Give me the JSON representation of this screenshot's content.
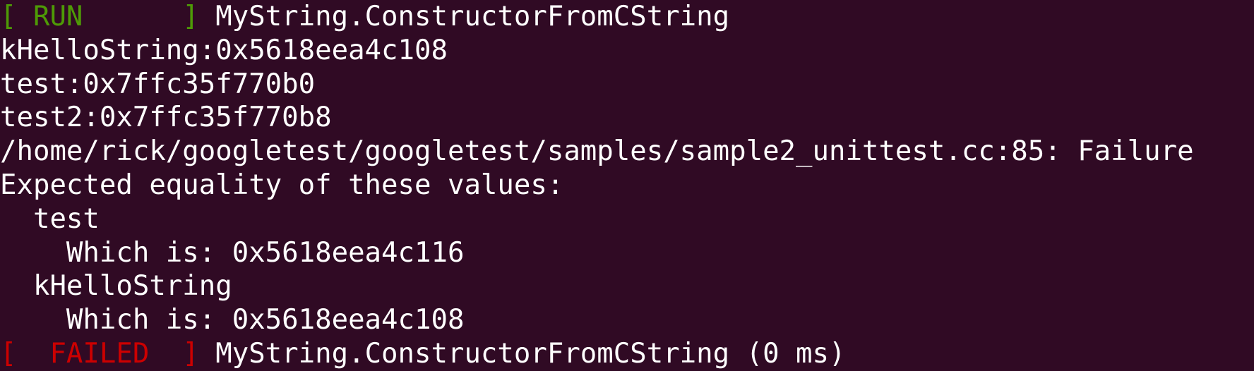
{
  "colors": {
    "background": "#300a24",
    "text": "#ffffff",
    "run_tag": "#4e9a06",
    "failed_tag": "#cc0000"
  },
  "terminal": {
    "lines": [
      {
        "tag": "[ RUN      ]",
        "text": " MyString.ConstructorFromCString"
      },
      {
        "text": "kHelloString:0x5618eea4c108"
      },
      {
        "text": "test:0x7ffc35f770b0"
      },
      {
        "text": "test2:0x7ffc35f770b8"
      },
      {
        "text": "/home/rick/googletest/googletest/samples/sample2_unittest.cc:85: Failure"
      },
      {
        "text": "Expected equality of these values:"
      },
      {
        "text": "  test"
      },
      {
        "text": "    Which is: 0x5618eea4c116"
      },
      {
        "text": "  kHelloString"
      },
      {
        "text": "    Which is: 0x5618eea4c108"
      },
      {
        "tag": "[  FAILED  ]",
        "text": " MyString.ConstructorFromCString (0 ms)"
      }
    ]
  }
}
